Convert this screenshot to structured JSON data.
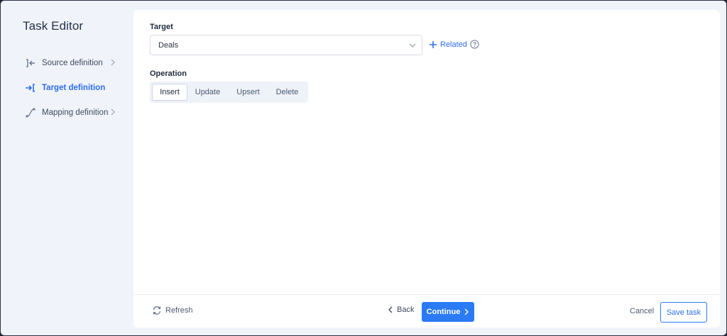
{
  "app": {
    "title": "Task Editor"
  },
  "sidebar": {
    "items": [
      {
        "label": "Source definition",
        "icon": "source-arrow-icon",
        "active": false,
        "has_chevron": true
      },
      {
        "label": "Target definition",
        "icon": "target-arrow-icon",
        "active": true,
        "has_chevron": false
      },
      {
        "label": "Mapping definition",
        "icon": "mapping-curve-icon",
        "active": false,
        "has_chevron": true
      }
    ]
  },
  "target": {
    "label": "Target",
    "value": "Deals",
    "related_label": "Related"
  },
  "operation": {
    "label": "Operation",
    "options": [
      "Insert",
      "Update",
      "Upsert",
      "Delete"
    ],
    "selected": "Insert"
  },
  "footer": {
    "refresh_label": "Refresh",
    "back_label": "Back",
    "continue_label": "Continue",
    "cancel_label": "Cancel",
    "save_label": "Save task"
  },
  "colors": {
    "accent": "#2a7bf5",
    "active_nav": "#2d6ff0",
    "sidebar_bg": "#f0f3fa",
    "card_bg": "#ffffff"
  }
}
